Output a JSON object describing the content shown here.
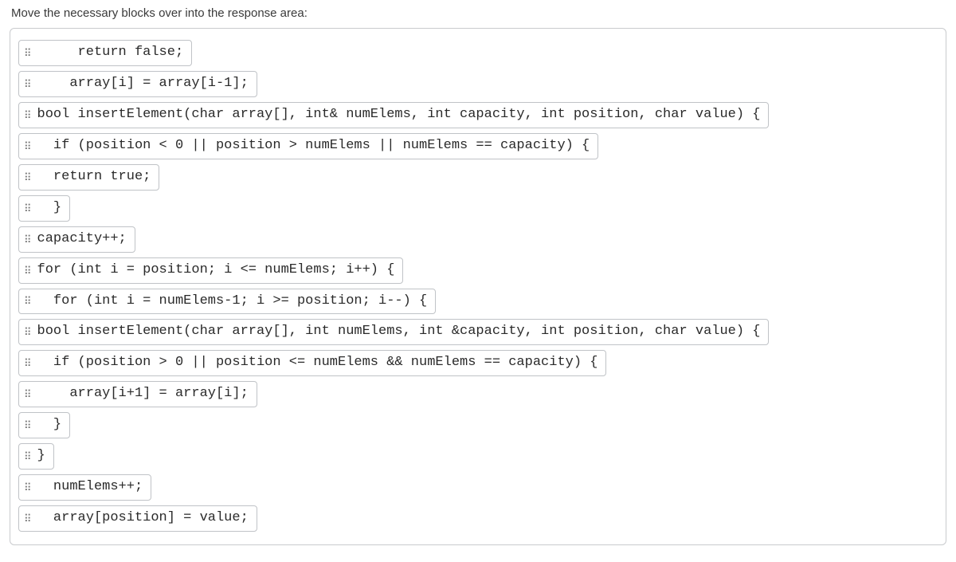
{
  "instruction": "Move the necessary blocks over into the response area:",
  "blocks": [
    {
      "code": "     return false;"
    },
    {
      "code": "    array[i] = array[i-1];"
    },
    {
      "code": "bool insertElement(char array[], int& numElems, int capacity, int position, char value) {"
    },
    {
      "code": "  if (position < 0 || position > numElems || numElems == capacity) {"
    },
    {
      "code": "  return true;"
    },
    {
      "code": "  }"
    },
    {
      "code": "capacity++;"
    },
    {
      "code": "for (int i = position; i <= numElems; i++) {"
    },
    {
      "code": "  for (int i = numElems-1; i >= position; i--) {"
    },
    {
      "code": "bool insertElement(char array[], int numElems, int &capacity, int position, char value) {"
    },
    {
      "code": "  if (position > 0 || position <= numElems && numElems == capacity) {"
    },
    {
      "code": "    array[i+1] = array[i];"
    },
    {
      "code": "  }"
    },
    {
      "code": "}"
    },
    {
      "code": "  numElems++;"
    },
    {
      "code": "  array[position] = value;"
    }
  ]
}
